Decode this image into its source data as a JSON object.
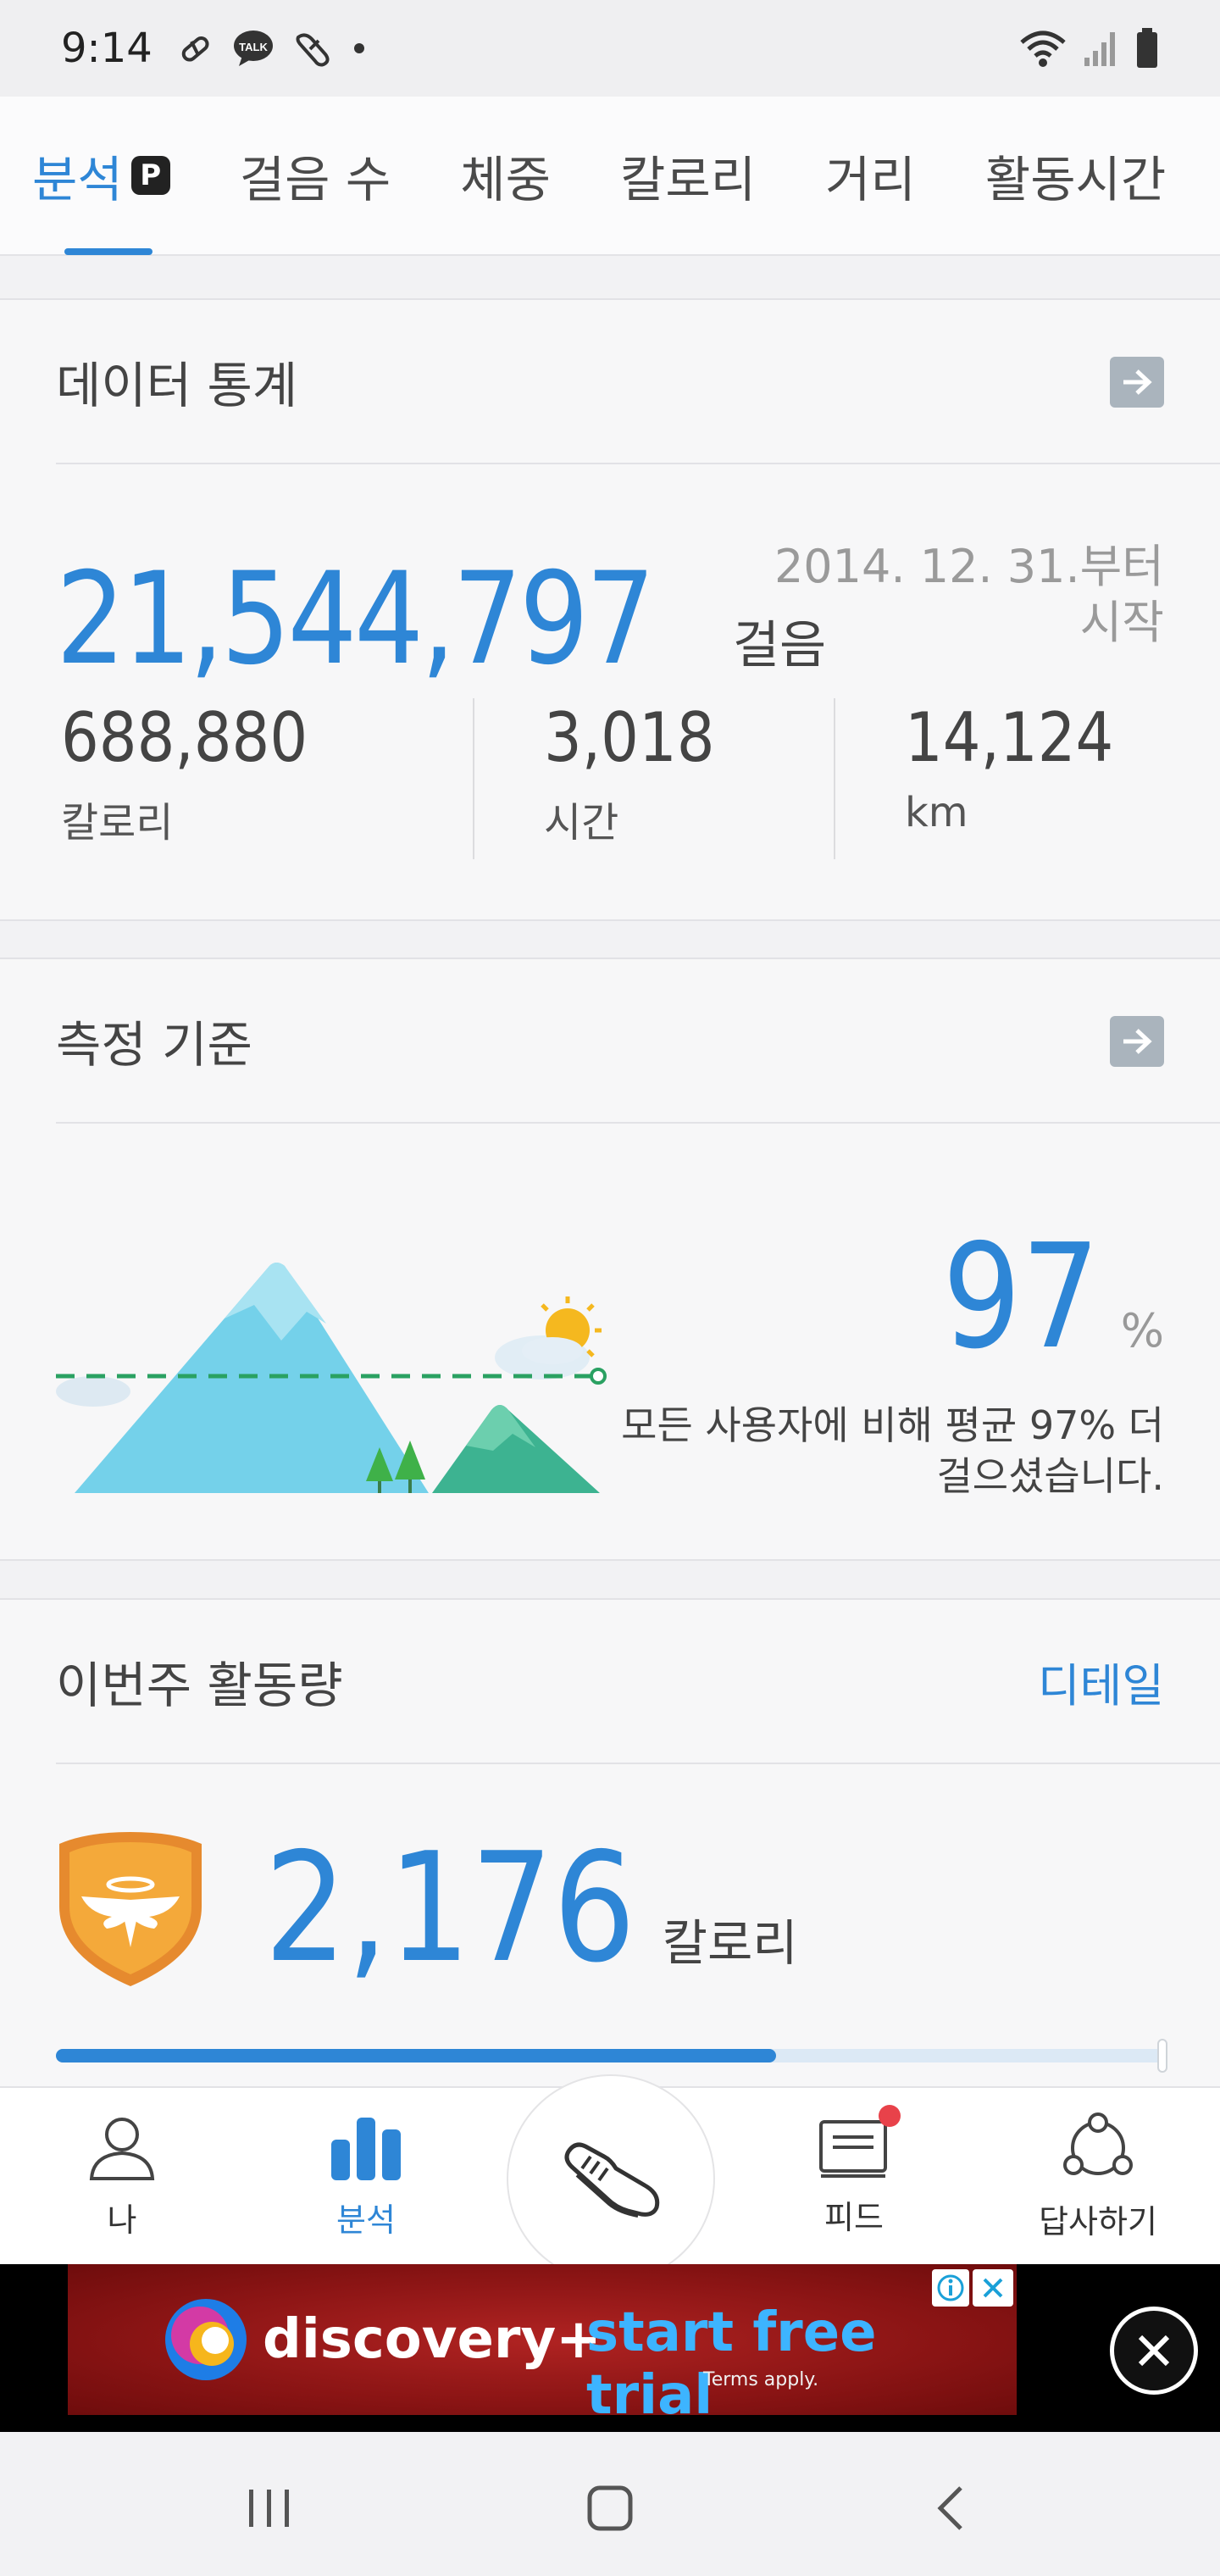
{
  "status_bar": {
    "time": "9:14",
    "left_icons": [
      "pill-icon",
      "talk-icon",
      "health-icon",
      "dot-icon"
    ],
    "right_icons": [
      "wifi-icon",
      "signal-icon",
      "battery-icon"
    ],
    "talk_label": "TALK"
  },
  "tabs": [
    {
      "label": "분석",
      "active": true,
      "badge": "P"
    },
    {
      "label": "걸음 수",
      "active": false
    },
    {
      "label": "체중",
      "active": false
    },
    {
      "label": "칼로리",
      "active": false
    },
    {
      "label": "거리",
      "active": false
    },
    {
      "label": "활동시간",
      "active": false
    }
  ],
  "data_stats": {
    "title": "데이터 통계",
    "total_steps": "21,544,797",
    "steps_unit": "걸음",
    "since_line1": "2014. 12. 31.부터",
    "since_line2": "시작",
    "metrics": [
      {
        "value": "688,880",
        "label": "칼로리"
      },
      {
        "value": "3,018",
        "label": "시간"
      },
      {
        "value": "14,124",
        "label": "km"
      }
    ]
  },
  "measure": {
    "title": "측정 기준",
    "percent": "97",
    "percent_unit": "%",
    "desc_line1": "모든 사용자에 비해 평균 97% 더",
    "desc_line2": "걸으셨습니다."
  },
  "weekly": {
    "title": "이번주 활동량",
    "detail_label": "디테일",
    "calories": "2,176",
    "calories_unit": "칼로리",
    "progress": 0.65
  },
  "bottom_nav": [
    {
      "label": "나",
      "icon": "person-icon",
      "active": false
    },
    {
      "label": "분석",
      "icon": "bar-chart-icon",
      "active": true
    },
    {
      "label": "",
      "icon": "shoe-icon",
      "active": false
    },
    {
      "label": "피드",
      "icon": "feed-icon",
      "active": false,
      "notification": true
    },
    {
      "label": "답사하기",
      "icon": "share-icon",
      "active": false
    }
  ],
  "ad": {
    "brand": "discovery+",
    "cta": "start free trial",
    "terms": "Terms apply."
  },
  "colors": {
    "accent": "#2e86d6",
    "mountain": "#74d1ea",
    "hill": "#3db391",
    "ad_bg": "#8a1414",
    "shield": "#f0a33a"
  }
}
